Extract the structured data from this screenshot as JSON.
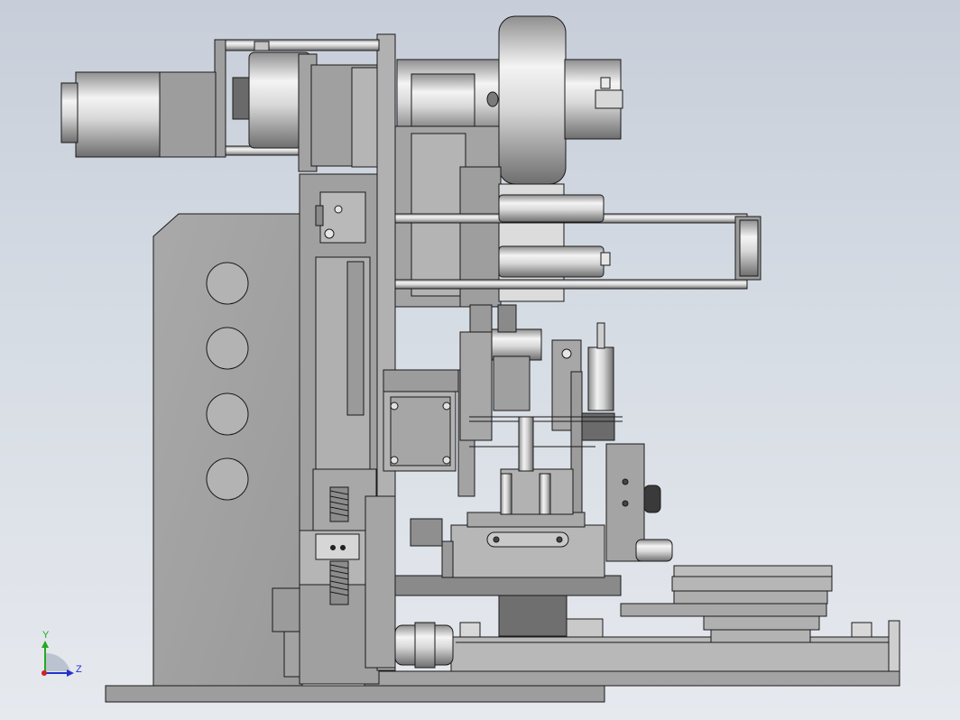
{
  "view": {
    "background_top": "#c7ced9",
    "background_bottom": "#e6e9ee"
  },
  "triad": {
    "y_label": "Y",
    "z_label": "Z",
    "y_color": "#22aa22",
    "z_color": "#2233cc"
  }
}
